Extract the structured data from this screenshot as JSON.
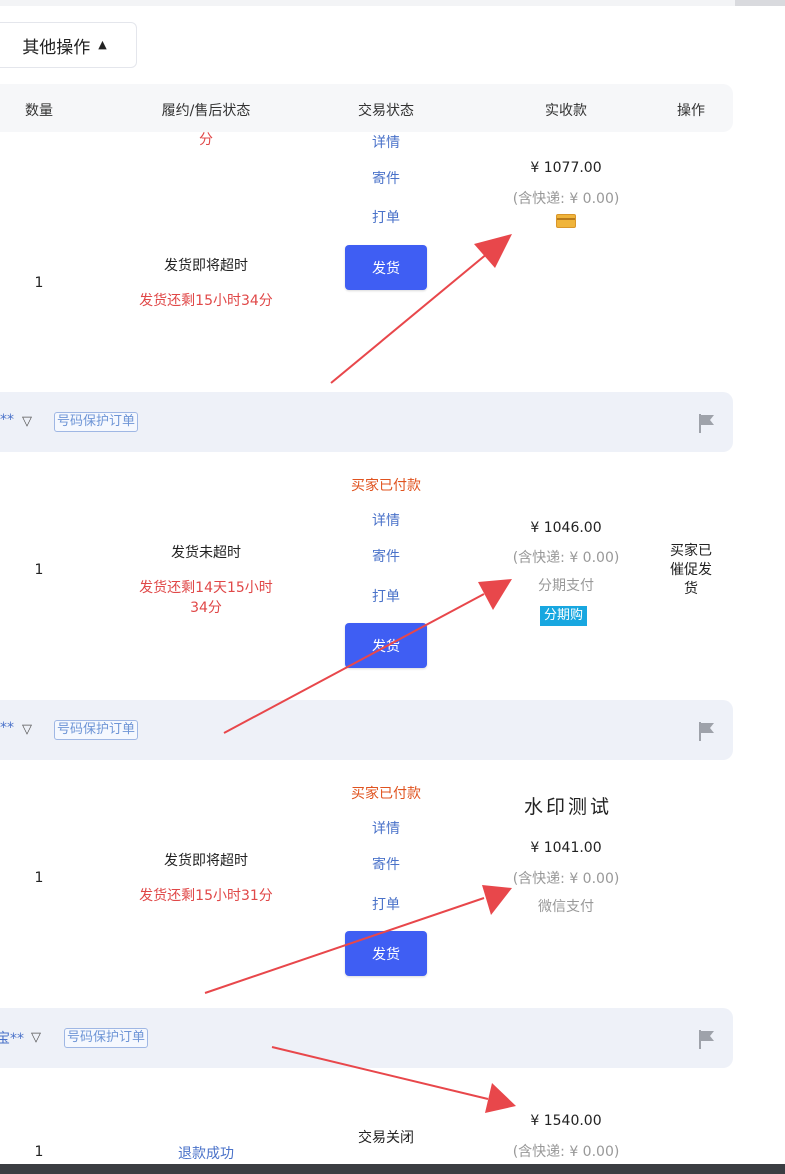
{
  "toolbar": {
    "other_ops_label": "其他操作",
    "caret": "⌃"
  },
  "table_header": {
    "quantity": "数量",
    "fulfillment": "履约/售后状态",
    "trade_status": "交易状态",
    "received": "实收款",
    "actions": "操作"
  },
  "orders": [
    {
      "top_fragment": "分",
      "quantity": "1",
      "fulfillment_status": "发货即将超时",
      "remaining": "发货还剩15小时34分",
      "links": {
        "detail": "详情",
        "mail": "寄件",
        "print": "打单"
      },
      "ship_button": "发货",
      "amount": "¥ 1077.00",
      "shipping_fee": "(含快递: ¥ 0.00)"
    },
    {
      "buyer_name": "**",
      "privacy_tag": "号码保护订单",
      "trade_status": "买家已付款",
      "quantity": "1",
      "fulfillment_status": "发货未超时",
      "remaining": "发货还剩14天15小时34分",
      "links": {
        "detail": "详情",
        "mail": "寄件",
        "print": "打单"
      },
      "ship_button": "发货",
      "amount": "¥ 1046.00",
      "shipping_fee": "(含快递: ¥ 0.00)",
      "pay_method": "分期支付",
      "installment_tag": "分期购",
      "action_note": "买家已催促发货"
    },
    {
      "buyer_name": "**",
      "privacy_tag": "号码保护订单",
      "trade_status": "买家已付款",
      "watermark": "水印测试",
      "quantity": "1",
      "fulfillment_status": "发货即将超时",
      "remaining": "发货还剩15小时31分",
      "links": {
        "detail": "详情",
        "mail": "寄件",
        "print": "打单"
      },
      "ship_button": "发货",
      "amount": "¥ 1041.00",
      "shipping_fee": "(含快递: ¥ 0.00)",
      "pay_method": "微信支付"
    },
    {
      "buyer_name": "宝**",
      "privacy_tag": "号码保护订单",
      "quantity": "1",
      "fulfillment_status": "退款成功",
      "trade_status": "交易关闭",
      "amount": "¥ 1540.00",
      "shipping_fee": "(含快递: ¥ 0.00)"
    }
  ],
  "icons": {
    "filter": "filter-icon",
    "flag": "flag-icon",
    "card": "card-icon"
  },
  "colors": {
    "accent": "#3f5ef3",
    "arrow": "#e8474b",
    "warn": "#e04848",
    "link": "#4a72c9"
  }
}
